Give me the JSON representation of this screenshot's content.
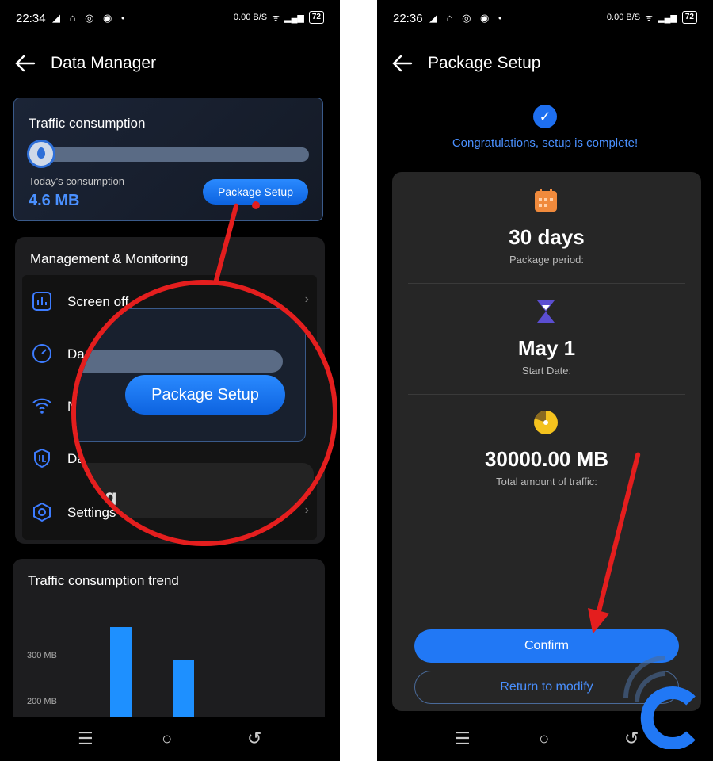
{
  "left": {
    "status": {
      "time": "22:34",
      "icons": "◢ ⌂ ◎ ◉ •",
      "net": "0.00 B/S",
      "battery": "72"
    },
    "title": "Data Manager",
    "traffic": {
      "heading": "Traffic consumption",
      "progress": 0.05,
      "today_label": "Today's consumption",
      "today_value": "4.6 MB",
      "package_button": "Package Setup"
    },
    "management": {
      "heading": "Management & Monitoring",
      "items": [
        {
          "label": "Screen off",
          "icon": "bar-chart-icon"
        },
        {
          "label": "Da",
          "icon": "gauge-icon"
        },
        {
          "label": "N",
          "icon": "wifi-icon"
        },
        {
          "label": "Da",
          "icon": "shield-icon"
        },
        {
          "label": "Settings",
          "icon": "settings-hexagon-icon"
        }
      ]
    },
    "magnifier": {
      "package_button": "Package Setup",
      "partial_text": "ng"
    },
    "trend": {
      "heading": "Traffic consumption trend",
      "y_labels": [
        "300 MB",
        "200 MB"
      ]
    }
  },
  "right": {
    "status": {
      "time": "22:36",
      "icons": "◢ ⌂ ◎ ◉ •",
      "net": "0.00 B/S",
      "battery": "72"
    },
    "title": "Package Setup",
    "congrats": "Congratulations, setup is complete!",
    "period": {
      "value": "30 days",
      "label": "Package period:",
      "icon": "calendar-icon"
    },
    "start": {
      "value": "May 1",
      "label": "Start Date:",
      "icon": "hourglass-icon"
    },
    "total": {
      "value": "30000.00 MB",
      "label": "Total amount of traffic:",
      "icon": "pie-icon"
    },
    "confirm": "Confirm",
    "modify": "Return to modify"
  },
  "colors": {
    "accent": "#2178f5",
    "annotation": "#e41e1e",
    "card": "#262626"
  }
}
